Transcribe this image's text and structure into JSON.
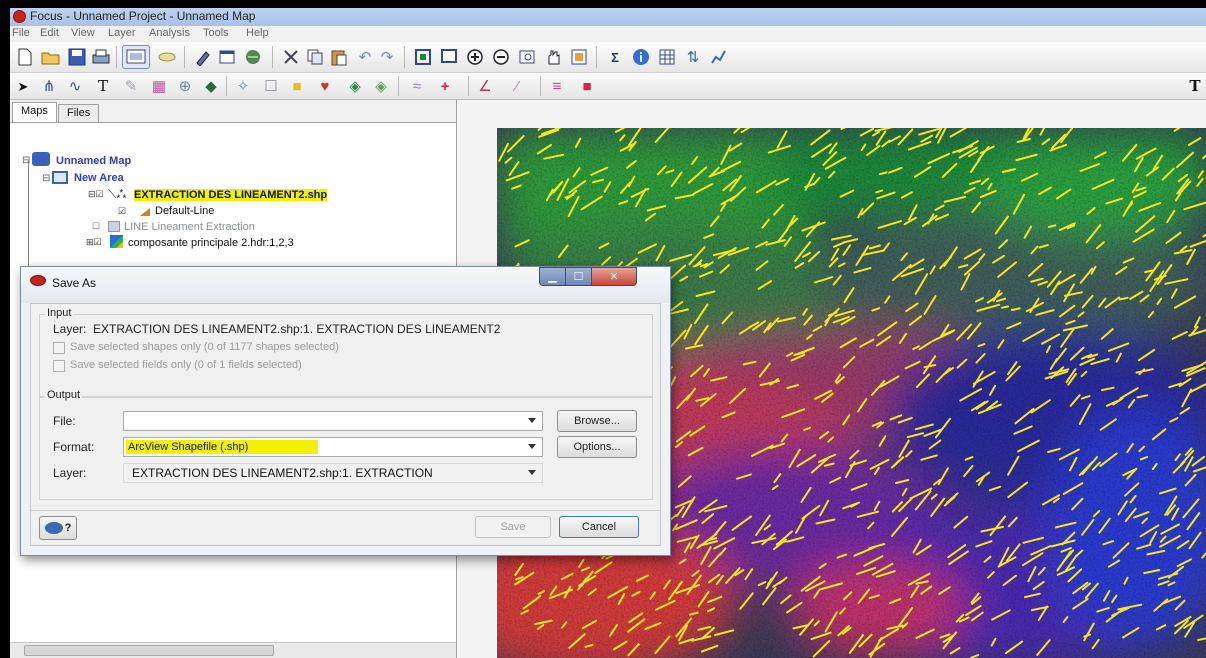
{
  "window": {
    "title": "Focus - Unnamed Project - Unnamed Map"
  },
  "menu": [
    "File",
    "Edit",
    "View",
    "Layer",
    "Analysis",
    "Tools",
    "Help"
  ],
  "left_panel": {
    "tabs": [
      "Maps",
      "Files"
    ],
    "tree": {
      "map": "Unnamed Map",
      "area": "New Area",
      "layer": "EXTRACTION DES LINEAMENT2.shp",
      "style": "Default-Line",
      "line_item": "LINE   Lineament Extraction",
      "raster": "composante principale 2.hdr:1,2,3"
    }
  },
  "dialog": {
    "title": "Save As",
    "input_group": "Input",
    "layer_label": "Layer:",
    "layer_value": "EXTRACTION DES LINEAMENT2.shp:1. EXTRACTION DES LINEAMENT2",
    "checkbox_shapes": "Save selected shapes only (0 of 1177 shapes selected)",
    "checkbox_fields": "Save selected fields only (0 of 1 fields selected)",
    "output_group": "Output",
    "file_label": "File:",
    "file_value": "",
    "browse_button": "Browse...",
    "format_label": "Format:",
    "format_value": "ArcView Shapefile (.shp)",
    "options_button": "Options...",
    "layer2_label": "Layer:",
    "layer2_value": "EXTRACTION DES LINEAMENT2.shp:1. EXTRACTION",
    "help_button": "?",
    "save_button": "Save",
    "cancel_button": "Cancel"
  },
  "colors": {
    "highlight": "#f2f200",
    "lineament": "#f5e620",
    "titlebar": "#a7c1e6",
    "close_button": "#c9453a"
  },
  "icons": {
    "toolbar1": [
      "new-icon",
      "open-icon",
      "save-icon",
      "print-icon",
      "screen-icon",
      "link-icon",
      "pen-icon",
      "window-icon",
      "layers-icon",
      "cut-icon",
      "copy-icon",
      "paste-icon",
      "undo-icon",
      "redo-icon",
      "zoom-full-icon",
      "zoom-box-icon",
      "zoom-in-icon",
      "zoom-out-icon",
      "zoom-select-icon",
      "pan-icon",
      "extent-icon",
      "stats-icon",
      "info-icon",
      "table-icon",
      "sort-icon",
      "chart-icon"
    ],
    "toolbar2": [
      "pointer-icon",
      "node-icon",
      "polyline-icon",
      "text-icon",
      "label-icon",
      "shapes-icon",
      "vertex-icon",
      "fill-icon",
      "symbol-icon",
      "grid-icon",
      "color-icon",
      "legend-icon",
      "layer-stack-icon",
      "layer-stack2-icon",
      "scale-icon",
      "crosshair-icon",
      "line-color-icon",
      "line-style-icon",
      "line-width-icon",
      "fill-color-icon",
      "font-icon"
    ]
  }
}
